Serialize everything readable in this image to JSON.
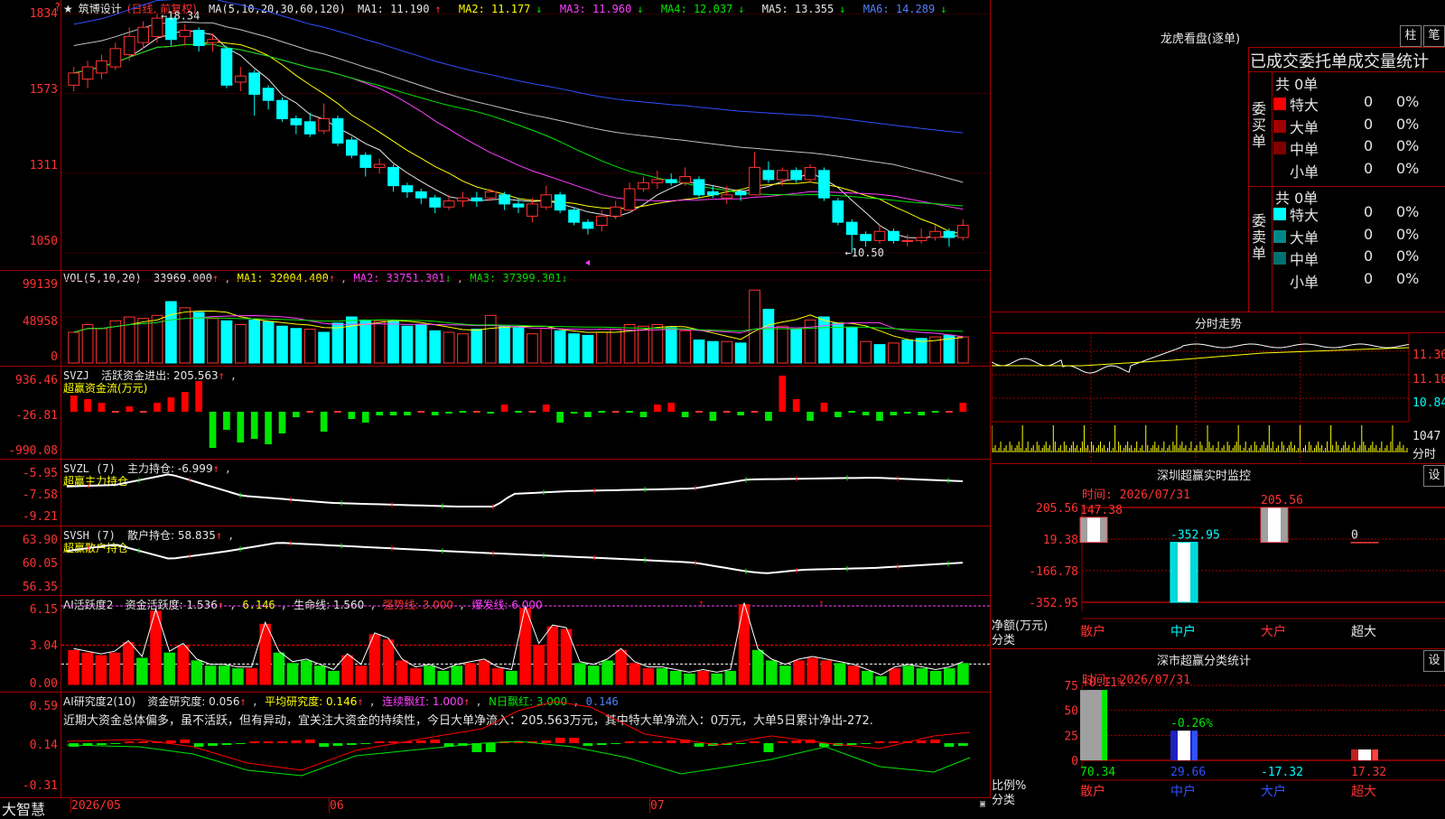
{
  "stock": {
    "name": "筑博设计",
    "period": "(日线, 前复权)",
    "star": "★",
    "menu_mark": "?"
  },
  "colors": {
    "up": "#ff3232",
    "down": "#00ffff",
    "ma1": "#e6e6e6",
    "ma2": "#ffff00",
    "ma3": "#ff40ff",
    "ma4": "#00e600",
    "ma5": "#c0c0c0",
    "ma6": "#3050ff",
    "grid": "#a00000"
  },
  "main": {
    "ma_title": "MA(5,10,20,30,60,120)",
    "ma": [
      {
        "label": "MA1: 11.190",
        "arrow": "↑"
      },
      {
        "label": "MA2: 11.177",
        "arrow": "↓"
      },
      {
        "label": "MA3: 11.960",
        "arrow": "↓"
      },
      {
        "label": "MA4: 12.037",
        "arrow": "↓"
      },
      {
        "label": "MA5: 13.355",
        "arrow": "↓"
      },
      {
        "label": "MA6: 14.289",
        "arrow": "↓"
      }
    ],
    "yticks": [
      "1834",
      "1573",
      "1311",
      "1050"
    ],
    "high_mark": "18.34",
    "low_mark": "10.50"
  },
  "candles": [
    {
      "o": 16.0,
      "c": 16.4,
      "h": 16.6,
      "l": 15.8
    },
    {
      "o": 16.2,
      "c": 16.6,
      "h": 16.8,
      "l": 15.9
    },
    {
      "o": 16.4,
      "c": 16.8,
      "h": 17.0,
      "l": 16.2
    },
    {
      "o": 16.6,
      "c": 17.2,
      "h": 17.4,
      "l": 16.5
    },
    {
      "o": 17.0,
      "c": 17.6,
      "h": 17.9,
      "l": 16.8
    },
    {
      "o": 17.4,
      "c": 17.9,
      "h": 18.1,
      "l": 17.2
    },
    {
      "o": 17.6,
      "c": 18.2,
      "h": 18.34,
      "l": 17.4
    },
    {
      "o": 18.2,
      "c": 17.5,
      "h": 18.3,
      "l": 17.3
    },
    {
      "o": 17.6,
      "c": 17.8,
      "h": 18.0,
      "l": 17.3
    },
    {
      "o": 17.8,
      "c": 17.3,
      "h": 17.9,
      "l": 17.1
    },
    {
      "o": 17.4,
      "c": 17.5,
      "h": 17.7,
      "l": 17.1
    },
    {
      "o": 17.2,
      "c": 16.0,
      "h": 17.3,
      "l": 15.9
    },
    {
      "o": 16.1,
      "c": 16.3,
      "h": 16.6,
      "l": 15.8
    },
    {
      "o": 16.4,
      "c": 15.7,
      "h": 16.5,
      "l": 15.0
    },
    {
      "o": 15.9,
      "c": 15.5,
      "h": 16.0,
      "l": 15.2
    },
    {
      "o": 15.5,
      "c": 14.9,
      "h": 15.6,
      "l": 14.8
    },
    {
      "o": 14.9,
      "c": 14.7,
      "h": 15.0,
      "l": 14.4
    },
    {
      "o": 14.8,
      "c": 14.4,
      "h": 15.1,
      "l": 14.3
    },
    {
      "o": 14.5,
      "c": 14.9,
      "h": 15.4,
      "l": 14.4
    },
    {
      "o": 14.9,
      "c": 14.1,
      "h": 15.0,
      "l": 14.0
    },
    {
      "o": 14.2,
      "c": 13.7,
      "h": 14.3,
      "l": 13.6
    },
    {
      "o": 13.7,
      "c": 13.3,
      "h": 13.8,
      "l": 13.0
    },
    {
      "o": 13.3,
      "c": 13.4,
      "h": 13.6,
      "l": 13.1
    },
    {
      "o": 13.3,
      "c": 12.7,
      "h": 13.4,
      "l": 12.5
    },
    {
      "o": 12.7,
      "c": 12.5,
      "h": 12.8,
      "l": 12.3
    },
    {
      "o": 12.5,
      "c": 12.3,
      "h": 12.6,
      "l": 12.1
    },
    {
      "o": 12.3,
      "c": 12.0,
      "h": 12.4,
      "l": 11.8
    },
    {
      "o": 12.0,
      "c": 12.2,
      "h": 12.4,
      "l": 11.9
    },
    {
      "o": 12.2,
      "c": 12.3,
      "h": 12.5,
      "l": 12.0
    },
    {
      "o": 12.3,
      "c": 12.2,
      "h": 12.5,
      "l": 12.0
    },
    {
      "o": 12.3,
      "c": 12.5,
      "h": 12.6,
      "l": 12.2
    },
    {
      "o": 12.4,
      "c": 12.1,
      "h": 12.5,
      "l": 11.9
    },
    {
      "o": 12.1,
      "c": 12.0,
      "h": 12.3,
      "l": 11.8
    },
    {
      "o": 11.7,
      "c": 12.1,
      "h": 12.3,
      "l": 11.5
    },
    {
      "o": 12.0,
      "c": 12.4,
      "h": 12.7,
      "l": 11.9
    },
    {
      "o": 12.4,
      "c": 11.9,
      "h": 12.5,
      "l": 11.8
    },
    {
      "o": 11.9,
      "c": 11.5,
      "h": 12.0,
      "l": 11.4
    },
    {
      "o": 11.5,
      "c": 11.3,
      "h": 11.6,
      "l": 11.1
    },
    {
      "o": 11.4,
      "c": 11.7,
      "h": 11.9,
      "l": 11.2
    },
    {
      "o": 11.7,
      "c": 12.0,
      "h": 12.2,
      "l": 11.6
    },
    {
      "o": 11.9,
      "c": 12.6,
      "h": 12.8,
      "l": 11.9
    },
    {
      "o": 12.6,
      "c": 12.8,
      "h": 13.0,
      "l": 12.5
    },
    {
      "o": 12.8,
      "c": 12.9,
      "h": 13.2,
      "l": 12.6
    },
    {
      "o": 12.9,
      "c": 12.8,
      "h": 13.1,
      "l": 12.7
    },
    {
      "o": 12.8,
      "c": 13.0,
      "h": 13.3,
      "l": 12.7
    },
    {
      "o": 12.9,
      "c": 12.4,
      "h": 13.0,
      "l": 12.3
    },
    {
      "o": 12.5,
      "c": 12.4,
      "h": 12.7,
      "l": 12.3
    },
    {
      "o": 12.3,
      "c": 12.4,
      "h": 12.7,
      "l": 12.1
    },
    {
      "o": 12.5,
      "c": 12.4,
      "h": 12.6,
      "l": 12.2
    },
    {
      "o": 12.4,
      "c": 13.3,
      "h": 13.8,
      "l": 12.4
    },
    {
      "o": 13.2,
      "c": 12.9,
      "h": 13.5,
      "l": 12.8
    },
    {
      "o": 12.9,
      "c": 13.2,
      "h": 13.3,
      "l": 12.7
    },
    {
      "o": 13.2,
      "c": 12.9,
      "h": 13.3,
      "l": 12.8
    },
    {
      "o": 12.9,
      "c": 13.3,
      "h": 13.4,
      "l": 12.8
    },
    {
      "o": 13.2,
      "c": 12.3,
      "h": 13.3,
      "l": 12.2
    },
    {
      "o": 12.2,
      "c": 11.5,
      "h": 12.3,
      "l": 11.4
    },
    {
      "o": 11.5,
      "c": 11.1,
      "h": 11.6,
      "l": 10.5
    },
    {
      "o": 11.1,
      "c": 10.9,
      "h": 11.2,
      "l": 10.7
    },
    {
      "o": 10.9,
      "c": 11.2,
      "h": 11.4,
      "l": 10.8
    },
    {
      "o": 11.2,
      "c": 10.9,
      "h": 11.3,
      "l": 10.8
    },
    {
      "o": 10.9,
      "c": 10.9,
      "h": 11.1,
      "l": 10.7
    },
    {
      "o": 10.9,
      "c": 11.0,
      "h": 11.3,
      "l": 10.8
    },
    {
      "o": 11.0,
      "c": 11.2,
      "h": 11.4,
      "l": 10.9
    },
    {
      "o": 11.2,
      "c": 11.0,
      "h": 11.3,
      "l": 10.7
    },
    {
      "o": 11.0,
      "c": 11.4,
      "h": 11.6,
      "l": 10.9
    }
  ],
  "vol": {
    "title": "VOL(5,10,20)",
    "value": "33969.000",
    "ma1": "MA1: 32004.400",
    "ma2": "MA2: 33751.301",
    "ma3": "MA3: 37399.301",
    "yticks": [
      "99139",
      "48958",
      "0"
    ],
    "values": [
      40,
      50,
      45,
      55,
      60,
      58,
      62,
      80,
      72,
      66,
      58,
      55,
      50,
      56,
      54,
      48,
      45,
      44,
      40,
      52,
      60,
      56,
      55,
      54,
      48,
      50,
      42,
      40,
      38,
      44,
      62,
      48,
      46,
      38,
      45,
      42,
      38,
      36,
      40,
      44,
      50,
      48,
      50,
      46,
      42,
      30,
      28,
      28,
      26,
      95,
      70,
      48,
      44,
      56,
      60,
      52,
      46,
      28,
      24,
      26,
      30,
      32,
      34,
      36,
      34
    ],
    "ups": [
      1,
      1,
      1,
      1,
      1,
      1,
      1,
      0,
      1,
      0,
      1,
      0,
      1,
      0,
      0,
      0,
      0,
      1,
      0,
      0,
      0,
      0,
      1,
      0,
      0,
      0,
      0,
      1,
      1,
      0,
      1,
      0,
      0,
      1,
      1,
      0,
      0,
      0,
      1,
      1,
      1,
      1,
      1,
      0,
      1,
      0,
      0,
      1,
      0,
      1,
      0,
      1,
      0,
      1,
      0,
      0,
      0,
      1,
      0,
      1,
      0,
      0,
      1,
      0,
      1
    ]
  },
  "svzj": {
    "title": "SVZJ",
    "field": "活跃资金进出: 205.563",
    "arrow": "↑",
    "sub": "超赢资金流(万元)",
    "yticks": [
      "936.46",
      "-26.81",
      "-990.08"
    ],
    "values": [
      18,
      14,
      10,
      0,
      6,
      0,
      10,
      16,
      22,
      34,
      -40,
      -20,
      -34,
      -30,
      -36,
      -24,
      -6,
      0,
      -22,
      0,
      -8,
      -12,
      -4,
      -4,
      -4,
      0,
      -4,
      -2,
      0,
      0,
      -2,
      8,
      0,
      0,
      8,
      -12,
      -2,
      -6,
      0,
      0,
      0,
      -6,
      8,
      10,
      -6,
      0,
      -10,
      0,
      -4,
      0,
      -10,
      40,
      14,
      -10,
      10,
      -6,
      0,
      -4,
      -10,
      -4,
      -2,
      -4,
      0,
      0,
      10
    ]
  },
  "svzl": {
    "title": "SVZL (7)",
    "field": "主力持仓: -6.999",
    "arrow": "↑",
    "sub": "超赢主力持仓",
    "yticks": [
      "-5.95",
      "-7.58",
      "-9.21"
    ]
  },
  "svsh": {
    "title": "SVSH (7)",
    "field": "散户持仓: 58.835",
    "arrow": "↑",
    "sub": "超赢散户持仓",
    "yticks": [
      "63.90",
      "60.05",
      "56.35"
    ]
  },
  "ai1": {
    "title": "AI活跃度2",
    "f1": "资金活跃度: 1.536",
    "a1": "↑",
    "f2": "6.146",
    "f3": "生命线: 1.560",
    "f4": "强势线: 3.000",
    "f5": "爆发线: 6.000",
    "yticks": [
      "6.15",
      "3.04",
      "0.00"
    ],
    "values": [
      2.6,
      2.4,
      2.2,
      2.4,
      3.2,
      2.0,
      5.6,
      2.4,
      3.0,
      1.8,
      1.4,
      1.4,
      1.2,
      1.2,
      4.6,
      2.4,
      1.6,
      1.8,
      1.4,
      1.0,
      2.2,
      1.4,
      3.8,
      3.4,
      1.8,
      1.2,
      1.4,
      1.0,
      1.4,
      1.6,
      1.8,
      1.2,
      1.0,
      5.8,
      3.0,
      4.4,
      4.2,
      1.6,
      1.4,
      1.8,
      2.6,
      1.6,
      1.2,
      1.2,
      1.0,
      0.8,
      1.0,
      0.8,
      1.0,
      6.1,
      2.6,
      1.8,
      1.4,
      1.8,
      2.0,
      1.8,
      1.6,
      1.4,
      1.0,
      0.6,
      1.2,
      1.4,
      1.2,
      1.0,
      1.2,
      1.6
    ],
    "ups": [
      1,
      1,
      1,
      1,
      1,
      0,
      1,
      0,
      1,
      0,
      0,
      0,
      0,
      1,
      1,
      0,
      0,
      0,
      0,
      0,
      1,
      1,
      1,
      1,
      1,
      1,
      0,
      0,
      0,
      1,
      1,
      1,
      0,
      1,
      1,
      1,
      1,
      0,
      0,
      0,
      1,
      1,
      1,
      0,
      0,
      0,
      1,
      0,
      0,
      1,
      0,
      0,
      0,
      1,
      1,
      1,
      0,
      1,
      0,
      0,
      1,
      0,
      0,
      0,
      0,
      0
    ]
  },
  "ai2": {
    "title": "AI研究度2(10)",
    "f1": "资金研究度: 0.056",
    "a1": "↑",
    "f2": "平均研究度: 0.146",
    "a2": "↑",
    "f3": "连续飘红: 1.000",
    "a3": "↑",
    "f4": "N日飘红: 3.000",
    "f5": "0.146",
    "yticks": [
      "0.59",
      "0.14",
      "-0.31"
    ],
    "comment": "近期大资金总体偏多，虽不活跃，但有异动，宜关注大资金的持续性，今日大单净流入：205.563万元，其中特大单净流入：0万元，大单5日累计净出-272."
  },
  "dates": [
    "2026/05",
    "06",
    "07"
  ],
  "brand": "大智慧",
  "lh": {
    "title": "龙虎看盘(逐单)",
    "btn1": "柱",
    "btn2": "笔",
    "subtitle": "已成交委托单成交量统计",
    "buy": {
      "side": "委买单",
      "total": "共 0单",
      "rows": [
        {
          "label": "特大",
          "vol": "0",
          "pct": "0%",
          "color": "#ff0000"
        },
        {
          "label": "大单",
          "vol": "0",
          "pct": "0%",
          "color": "#a00000"
        },
        {
          "label": "中单",
          "vol": "0",
          "pct": "0%",
          "color": "#800000"
        },
        {
          "label": "小单",
          "vol": "0",
          "pct": "0%",
          "color": "#000000"
        }
      ]
    },
    "sell": {
      "side": "委卖单",
      "total": "共 0单",
      "rows": [
        {
          "label": "特大",
          "vol": "0",
          "pct": "0%",
          "color": "#00ffff"
        },
        {
          "label": "大单",
          "vol": "0",
          "pct": "0%",
          "color": "#008888"
        },
        {
          "label": "中单",
          "vol": "0",
          "pct": "0%",
          "color": "#007070"
        },
        {
          "label": "小单",
          "vol": "0",
          "pct": "0%",
          "color": "#000000"
        }
      ]
    }
  },
  "fs": {
    "title": "分时走势",
    "yticks": [
      "11.36",
      "11.10",
      "10.84"
    ],
    "vol_label": "1047",
    "vol_unit": "分时"
  },
  "sz": {
    "title": "深圳超赢实时监控",
    "btn": "设",
    "time": "时间: 2026/07/31",
    "yticks": [
      "205.56",
      "19.38",
      "-166.78",
      "-352.95"
    ],
    "ylabel": "净额(万元)",
    "xlabel": "分类",
    "chart_data": {
      "type": "bar",
      "categories": [
        "散户",
        "中户",
        "大户",
        "超大"
      ],
      "values": [
        147.38,
        -352.95,
        205.56,
        0
      ],
      "labels": [
        "147.38",
        "-352.95",
        "205.56",
        "0"
      ],
      "ylim": [
        -352.95,
        205.56
      ]
    }
  },
  "sc": {
    "title": "深市超赢分类统计",
    "btn": "设",
    "time": "时间: 2026/07/31",
    "yticks": [
      "75",
      "50",
      "25",
      "0"
    ],
    "ylabel": "比例%",
    "xlabel": "分类",
    "chart_data": {
      "type": "bar",
      "categories": [
        "散户",
        "中户",
        "大户",
        "超大"
      ],
      "values": [
        70.34,
        29.66,
        17.32,
        17.32
      ],
      "top_labels": [
        "+0.11%",
        "-0.26%",
        "",
        ""
      ],
      "bottom_labels": [
        "70.34",
        "29.66",
        "-17.32",
        "17.32"
      ]
    }
  }
}
